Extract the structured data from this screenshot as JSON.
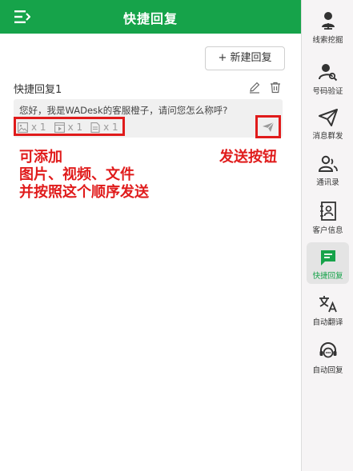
{
  "header": {
    "title": "快捷回复"
  },
  "toolbar": {
    "new_label": "+ 新建回复"
  },
  "reply": {
    "title": "快捷回复1",
    "text": "您好，我是WADesk的客服橙子，请问您怎么称呼?",
    "attachments": [
      {
        "icon": "image-icon",
        "count": "x 1"
      },
      {
        "icon": "video-icon",
        "count": "x 1"
      },
      {
        "icon": "file-icon",
        "count": "x 1"
      }
    ]
  },
  "annotations": {
    "left_line1": "可添加",
    "left_line2": "图片、视频、文件",
    "left_line3": "并按照这个顺序发送",
    "right": "发送按钮"
  },
  "sidebar": {
    "items": [
      {
        "label": "线索挖掘",
        "icon": "person-pin-icon"
      },
      {
        "label": "号码验证",
        "icon": "person-search-icon"
      },
      {
        "label": "消息群发",
        "icon": "paper-plane-icon"
      },
      {
        "label": "通讯录",
        "icon": "contacts-icon"
      },
      {
        "label": "客户信息",
        "icon": "contact-card-icon"
      },
      {
        "label": "快捷回复",
        "icon": "quick-reply-icon",
        "active": true
      },
      {
        "label": "自动翻译",
        "icon": "translate-icon"
      },
      {
        "label": "自动回复",
        "icon": "headset-chat-icon"
      }
    ]
  },
  "colors": {
    "brand": "#16a34a",
    "annotation": "#e01b1b"
  }
}
